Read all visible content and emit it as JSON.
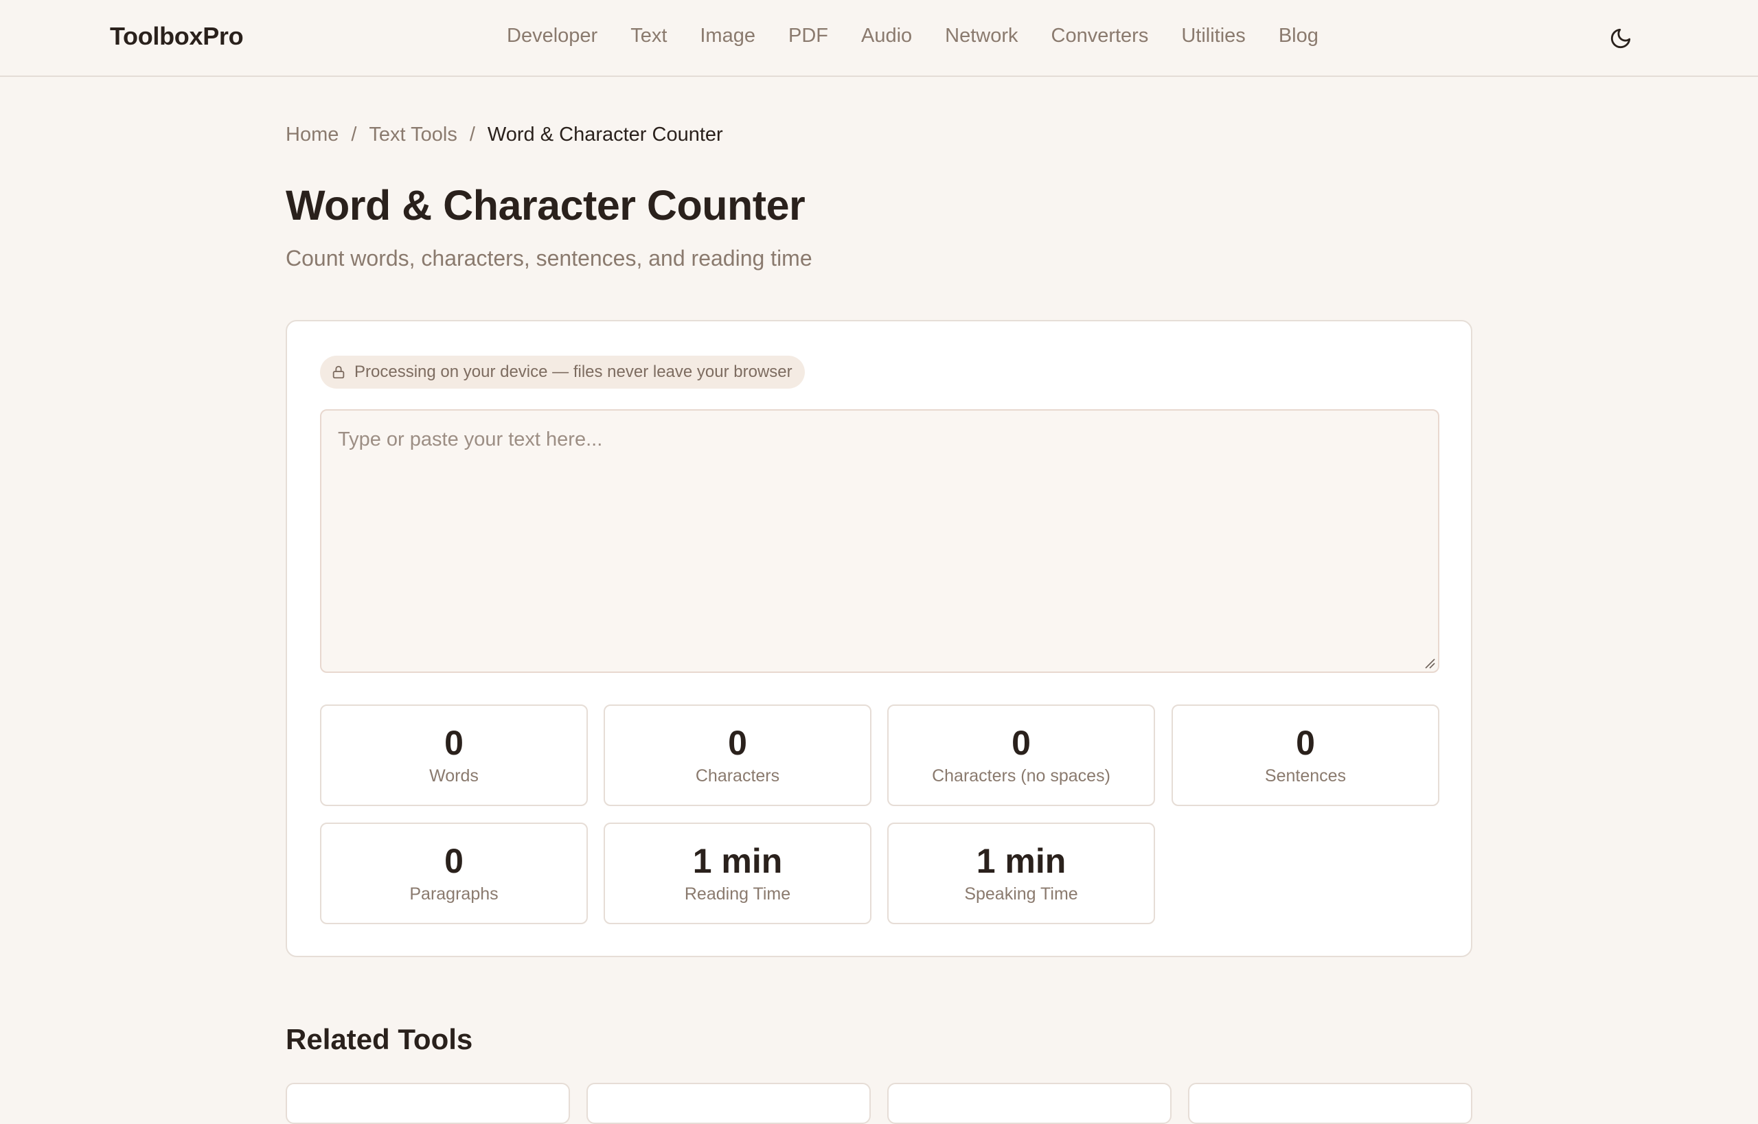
{
  "header": {
    "brand": "ToolboxPro",
    "nav": [
      "Developer",
      "Text",
      "Image",
      "PDF",
      "Audio",
      "Network",
      "Converters",
      "Utilities",
      "Blog"
    ],
    "theme_icon": "moon-icon"
  },
  "breadcrumb": {
    "home": "Home",
    "separator": "/",
    "section": "Text Tools",
    "current": "Word & Character Counter"
  },
  "page": {
    "title": "Word & Character Counter",
    "subtitle": "Count words, characters, sentences, and reading time"
  },
  "tool": {
    "privacy_icon": "lock-icon",
    "privacy_note": "Processing on your device — files never leave your browser",
    "input_value": "",
    "input_placeholder": "Type or paste your text here...",
    "stats": [
      {
        "value": "0",
        "label": "Words"
      },
      {
        "value": "0",
        "label": "Characters"
      },
      {
        "value": "0",
        "label": "Characters (no spaces)"
      },
      {
        "value": "0",
        "label": "Sentences"
      },
      {
        "value": "0",
        "label": "Paragraphs"
      },
      {
        "value": "1 min",
        "label": "Reading Time"
      },
      {
        "value": "1 min",
        "label": "Speaking Time"
      }
    ]
  },
  "related": {
    "title": "Related Tools"
  },
  "colors": {
    "background": "#f9f5f1",
    "text": "#2a211c",
    "muted": "#8a7a6e",
    "badge": "#f4ebe3"
  }
}
